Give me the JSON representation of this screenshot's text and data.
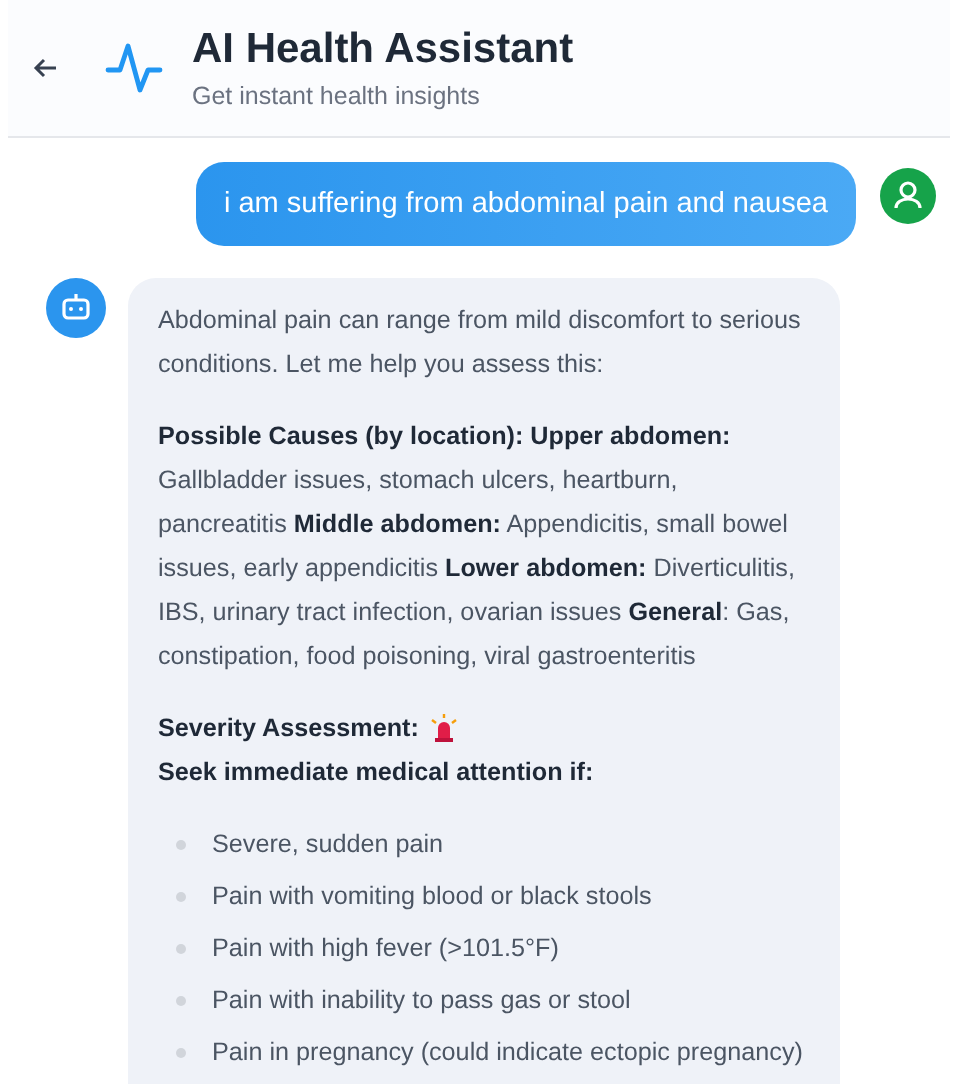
{
  "header": {
    "title": "AI Health Assistant",
    "subtitle": "Get instant health insights"
  },
  "messages": [
    {
      "kind": "user",
      "text": "i am suffering from abdominal pain and nausea"
    },
    {
      "kind": "bot",
      "intro": "Abdominal pain can range from mild discomfort to serious conditions. Let me help you assess this:",
      "causes": "**Possible Causes (by location): Upper abdomen:** Gallbladder issues, stomach ulcers, heartburn, pancreatitis **Middle abdomen:** Appendicitis, small bowel issues, early appendicitis **Lower abdomen:** Diverticulitis, IBS, urinary tract infection, ovarian issues **General**: Gas, constipation, food poisoning, viral gastroenteritis",
      "severity_label": "Severity Assessment:",
      "severity_warning": "Seek immediate medical attention if:",
      "bullets": [
        "Severe, sudden pain",
        "Pain with vomiting blood or black stools",
        "Pain with high fever (>101.5°F)",
        "Pain with inability to pass gas or stool",
        "Pain in pregnancy (could indicate ectopic pregnancy)"
      ]
    }
  ]
}
